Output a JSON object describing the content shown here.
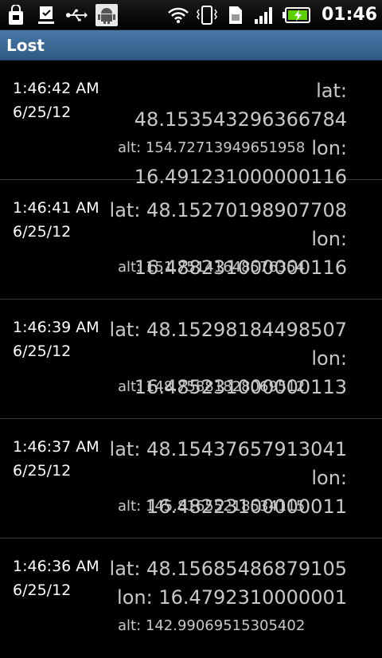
{
  "status_bar": {
    "clock": "01:46",
    "icons": [
      "shopping-bag-icon",
      "download-check-icon",
      "usb-icon",
      "android-debug-icon",
      "wifi-icon",
      "vibrate-icon",
      "sim-icon",
      "signal-icon",
      "battery-charging-icon"
    ]
  },
  "header": {
    "title": "Lost"
  },
  "entries": [
    {
      "time": "1:46:42 AM",
      "date": "6/25/12",
      "lat": "lat: 48.153543296366784",
      "lon": "lon: 16.491231000000116",
      "alt": "alt: 154.72713949651958"
    },
    {
      "time": "1:46:41 AM",
      "date": "6/25/12",
      "lat": "lat: 48.15270198907708",
      "lon": "lon: 16.488231000000116",
      "alt": "alt: 151.75141648576354"
    },
    {
      "time": "1:46:39 AM",
      "date": "6/25/12",
      "lat": "lat: 48.15298184498507",
      "lon": "lon: 16.485231000000113",
      "alt": "alt: 148.75881828069512"
    },
    {
      "time": "1:46:37 AM",
      "date": "6/25/12",
      "lat": "lat: 48.15437657913041",
      "lon": "lon: 16.48223100000011",
      "alt": "alt: 145.81655218534115"
    },
    {
      "time": "1:46:36 AM",
      "date": "6/25/12",
      "lat": "lat: 48.15685486879105",
      "lon": "lon: 16.4792310000001",
      "alt": "alt: 142.99069515305402"
    }
  ],
  "colors": {
    "title_bar": "#3d6b99",
    "background": "#000000",
    "text": "#ffffff",
    "secondary_text": "#c8c8c8"
  }
}
